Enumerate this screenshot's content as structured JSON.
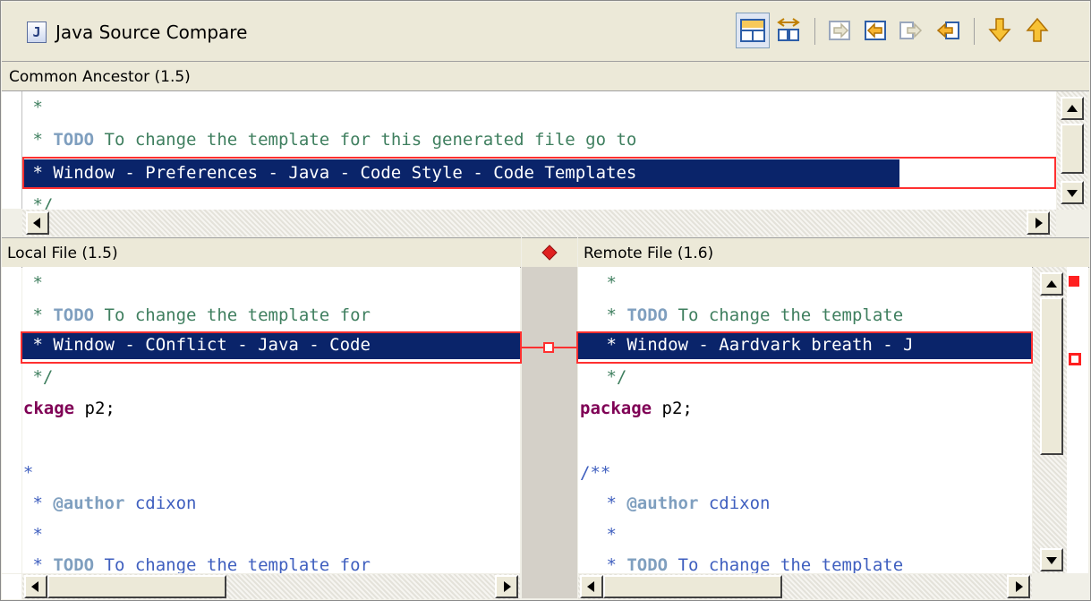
{
  "window": {
    "title": "Java Source Compare",
    "title_icon": "java-file-icon"
  },
  "toolbar": {
    "buttons": [
      {
        "name": "show-ancestor-pane-button",
        "icon": "ancestor-pane-icon",
        "pressed": true
      },
      {
        "name": "ignore-whitespace-button",
        "icon": "ignore-whitespace-icon",
        "pressed": false
      },
      {
        "name": "copy-all-left-to-right-button",
        "icon": "copy-all-right-icon",
        "pressed": false
      },
      {
        "name": "copy-current-change-left-button",
        "icon": "copy-change-right-icon",
        "pressed": false
      },
      {
        "name": "copy-all-right-to-left-button",
        "icon": "copy-all-left-icon",
        "pressed": false
      },
      {
        "name": "copy-current-change-right-button",
        "icon": "copy-change-left-icon",
        "pressed": false
      },
      {
        "name": "next-difference-button",
        "icon": "arrow-down-icon",
        "pressed": false
      },
      {
        "name": "previous-difference-button",
        "icon": "arrow-up-icon",
        "pressed": false
      }
    ]
  },
  "ancestor": {
    "label": "Common Ancestor (1.5)",
    "lines": {
      "l1": " *",
      "l2_todo": "TODO",
      "l2_rest": " To change the template for this generated file go to",
      "l3": " * Window - Preferences - Java - Code Style - Code Templates",
      "l4": " */"
    }
  },
  "local": {
    "label": "Local File (1.5)",
    "lines": {
      "l1": " *",
      "l2_todo": "TODO",
      "l2_rest": " To change the template for",
      "l3": " * Window - COnflict - Java - Code",
      "l4": " */",
      "pkg_kw": "package",
      "pkg_rest": " p2;",
      "l6": "",
      "l7": "/**",
      "l8_tag": "@author",
      "l8_rest": " cdixon",
      "l9": " *",
      "l10_todo": "TODO",
      "l10_rest": " To change the template for"
    }
  },
  "remote": {
    "label": "Remote File (1.6)",
    "lines": {
      "l1": " *",
      "l2_todo": "TODO",
      "l2_rest": " To change the template",
      "l3": " * Window - Aardvark breath - J",
      "l4": " */",
      "pkg_kw": "package",
      "pkg_rest": " p2;",
      "l6": "",
      "l7": "/**",
      "l8_tag": "@author",
      "l8_rest": " cdixon",
      "l9": " *",
      "l10_todo": "TODO",
      "l10_rest": " To change the template"
    }
  },
  "colors": {
    "conflict": "#ff3030",
    "selection": "#0a246a",
    "comment": "#3f7f5f",
    "keyword": "#7f0055",
    "javadoc": "#3f5fbf"
  }
}
